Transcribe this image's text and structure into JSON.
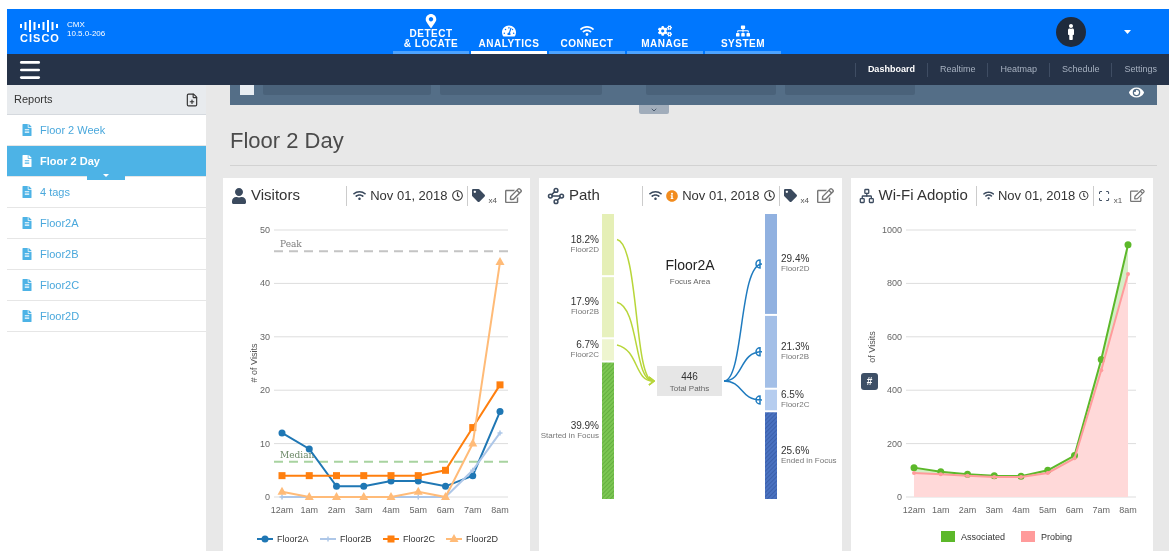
{
  "header": {
    "brand": "CISCO",
    "product": "CMX",
    "version": "10.5.0-206",
    "tabs": [
      {
        "label": "DETECT\n& LOCATE",
        "selected": false
      },
      {
        "label": "ANALYTICS",
        "selected": true
      },
      {
        "label": "CONNECT",
        "selected": false
      },
      {
        "label": "MANAGE",
        "selected": false
      },
      {
        "label": "SYSTEM",
        "selected": false
      }
    ]
  },
  "subnav": [
    {
      "label": "Dashboard",
      "selected": true
    },
    {
      "label": "Realtime",
      "selected": false
    },
    {
      "label": "Heatmap",
      "selected": false
    },
    {
      "label": "Schedule",
      "selected": false
    },
    {
      "label": "Settings",
      "selected": false
    }
  ],
  "sidebar": {
    "title": "Reports",
    "items": [
      {
        "label": "Floor 2 Week",
        "selected": false
      },
      {
        "label": "Floor 2 Day",
        "selected": true
      },
      {
        "label": "4 tags",
        "selected": false
      },
      {
        "label": "Floor2A",
        "selected": false
      },
      {
        "label": "Floor2B",
        "selected": false
      },
      {
        "label": "Floor2C",
        "selected": false
      },
      {
        "label": "Floor2D",
        "selected": false
      }
    ]
  },
  "page_title": "Floor 2 Day",
  "cards": [
    {
      "kind": "visitors",
      "title": "Visitors",
      "date": "Nov 01, 2018",
      "warning": false,
      "filter": {
        "kind": "tags",
        "count": "x4"
      },
      "chart_data": {
        "type": "line",
        "ylabel": "# of Visits",
        "categories": [
          "12am",
          "1am",
          "2am",
          "3am",
          "4am",
          "5am",
          "6am",
          "7am",
          "8am"
        ],
        "ylim": [
          0,
          50
        ],
        "yticks": [
          0,
          10,
          20,
          30,
          40,
          50
        ],
        "grid": true,
        "legend": "bottom",
        "series": [
          {
            "name": "Floor2A",
            "color": "#1f77b4",
            "marker": "circle",
            "values": [
              12,
              9,
              2,
              2,
              3,
              3,
              2,
              4,
              16
            ]
          },
          {
            "name": "Floor2B",
            "color": "#aec7e8",
            "marker": "plus",
            "values": [
              0,
              0,
              0,
              0,
              0,
              0,
              0,
              5,
              12
            ]
          },
          {
            "name": "Floor2C",
            "color": "#ff7f0e",
            "marker": "square",
            "values": [
              4,
              4,
              4,
              4,
              4,
              4,
              5,
              13,
              21
            ]
          },
          {
            "name": "Floor2D",
            "color": "#ffbb78",
            "marker": "triangle",
            "values": [
              1,
              0,
              0,
              0,
              0,
              1,
              0,
              10,
              44
            ]
          }
        ],
        "ref_lines": [
          {
            "axis": "y",
            "value": 46,
            "label": "Peak",
            "color": "#c4c4c4"
          },
          {
            "axis": "y",
            "value": 6.6,
            "label": "Median",
            "color": "#a8d3a0"
          }
        ]
      }
    },
    {
      "kind": "path",
      "title": "Path",
      "date": "Nov 01, 2018",
      "warning": true,
      "filter": {
        "kind": "tags",
        "count": "x4"
      },
      "focus": {
        "name": "Floor2A",
        "caption": "Focus Area"
      },
      "total": {
        "value": "446",
        "caption": "Total Paths"
      },
      "sources": [
        {
          "percent": "18.2%",
          "label": "Floor2D",
          "kind": "floor"
        },
        {
          "percent": "17.9%",
          "label": "Floor2B",
          "kind": "floor"
        },
        {
          "percent": "6.7%",
          "label": "Floor2C",
          "kind": "floor"
        },
        {
          "percent": "39.9%",
          "label": "Started in Focus",
          "kind": "focus"
        }
      ],
      "destinations": [
        {
          "percent": "29.4%",
          "label": "Floor2D",
          "kind": "floor"
        },
        {
          "percent": "21.3%",
          "label": "Floor2B",
          "kind": "floor"
        },
        {
          "percent": "6.5%",
          "label": "Floor2C",
          "kind": "floor"
        },
        {
          "percent": "25.6%",
          "label": "Ended in Focus",
          "kind": "focus"
        }
      ]
    },
    {
      "kind": "wifi",
      "title": "Wi-Fi Adoptio",
      "date": "Nov 01, 2018",
      "warning": false,
      "filter": {
        "kind": "zones",
        "count": "x1"
      },
      "axis_badge": "#",
      "chart_data": {
        "type": "area",
        "ylabel": "of Visits",
        "categories": [
          "12am",
          "1am",
          "2am",
          "3am",
          "4am",
          "5am",
          "6am",
          "7am",
          "8am"
        ],
        "ylim": [
          0,
          1000
        ],
        "yticks": [
          0,
          200,
          400,
          600,
          800,
          1000
        ],
        "grid": true,
        "legend": "bottom",
        "series": [
          {
            "name": "Associated",
            "color": "#5cb82a",
            "values": [
              110,
              95,
              85,
              80,
              78,
              100,
              155,
              515,
              945
            ]
          },
          {
            "name": "Probing",
            "color": "#ff9b9b",
            "values": [
              90,
              85,
              80,
              75,
              75,
              90,
              145,
              475,
              835
            ]
          }
        ]
      }
    }
  ]
}
